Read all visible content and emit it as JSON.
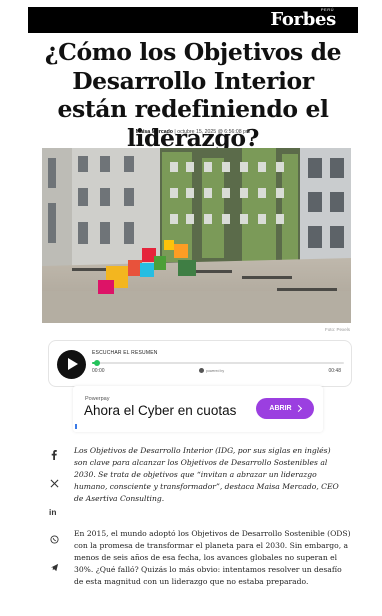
{
  "header": {
    "brand": "Forbes",
    "brand_sup": "PERÚ"
  },
  "article": {
    "title": "¿Cómo los Objetivos de Desarrollo Interior están redefiniendo el liderazgo?",
    "author": "Maisa Mercado",
    "date": "| octubre 15, 2025 @ 6:56:08 pm",
    "photo_credit": "Foto: Pexels"
  },
  "audio_player": {
    "label": "ESCUCHAR EL RESUMEN",
    "current_time": "00:00",
    "total_time": "00:48",
    "progress": 0.02,
    "powered_by": "powered by"
  },
  "ad": {
    "brand": "Powerpay",
    "text": "Ahora el Cyber en cuotas",
    "button": "ABRIR"
  },
  "share_icons": [
    "facebook-icon",
    "x-icon",
    "linkedin-icon",
    "whatsapp-icon",
    "telegram-icon"
  ],
  "body": {
    "intro": "Los Objetivos de Desarrollo Interior (IDG, por sus siglas en inglés) son clave para alcanzar los Objetivos de Desarrollo Sostenibles al 2030. Se trata de objetivos que “invitan a abrazar un liderazgo humano, consciente y transformador”, destaca Maisa Mercado, CEO de Asertiva Consulting.",
    "paragraph_1": "En 2015, el mundo adoptó los Objetivos de Desarrollo Sostenible (ODS) con la promesa de transformar el planeta para el 2030. Sin embargo, a menos de seis años de esa fecha, los avances globales no superan el 30%. ¿Qué falló? Quizás lo más obvio: intentamos resolver un desafío de esta magnitud con un liderazgo que no estaba preparado."
  },
  "colors": {
    "accent_green": "#24c35b",
    "ad_button": "#9b3fe0",
    "topbar": "#000000"
  }
}
